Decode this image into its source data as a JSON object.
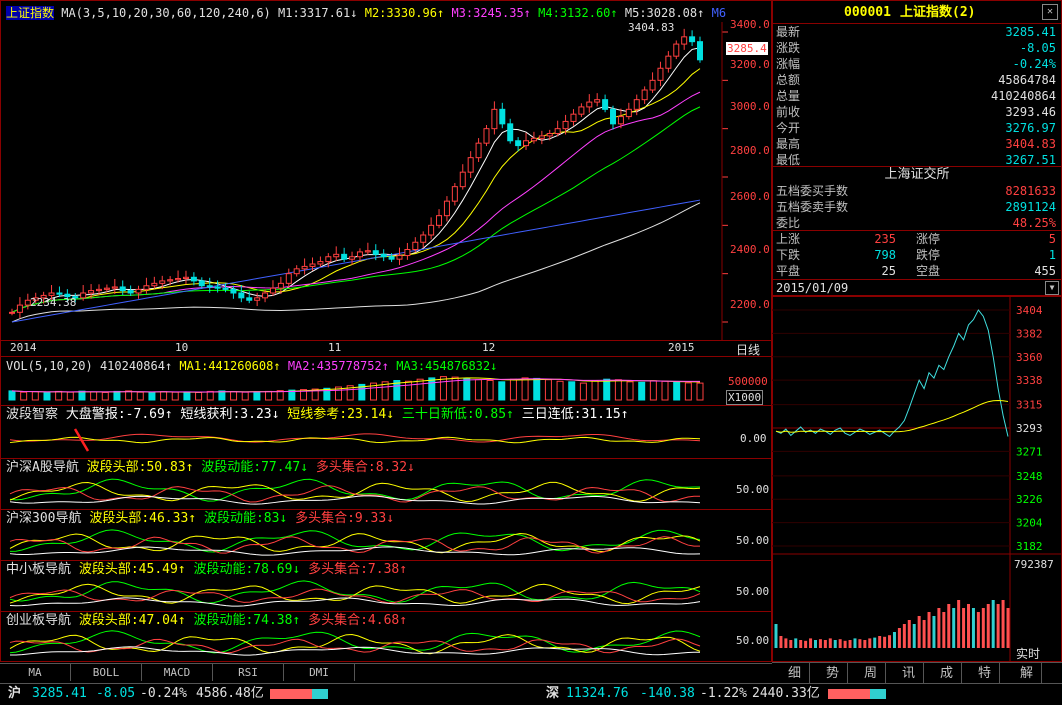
{
  "kline_header": {
    "name": "上证指数",
    "ma_params": "MA(3,5,10,20,30,60,120,240,6)",
    "m1": "M1:3317.61↓",
    "m2": "M2:3330.96↑",
    "m3": "M3:3245.35↑",
    "m4": "M4:3132.60↑",
    "m5": "M5:3028.08↑",
    "m6": "M6"
  },
  "kline": {
    "high_label": "3404.83",
    "low_label": "2234.38",
    "cur_tag": "3285.4",
    "y_axis": [
      "3400.0",
      "3200.0",
      "3000.0",
      "2800.0",
      "2600.0",
      "2400.0",
      "2200.0"
    ],
    "x_axis": [
      "2014",
      "10",
      "11",
      "12",
      "2015"
    ],
    "period": "日线",
    "closes": [
      2240,
      2270,
      2290,
      2300,
      2310,
      2320,
      2315,
      2305,
      2300,
      2320,
      2330,
      2335,
      2340,
      2345,
      2330,
      2320,
      2335,
      2350,
      2360,
      2370,
      2375,
      2380,
      2385,
      2370,
      2350,
      2345,
      2340,
      2335,
      2320,
      2300,
      2290,
      2300,
      2320,
      2340,
      2360,
      2400,
      2420,
      2430,
      2440,
      2450,
      2470,
      2480,
      2460,
      2470,
      2490,
      2495,
      2480,
      2470,
      2460,
      2475,
      2500,
      2530,
      2560,
      2600,
      2640,
      2700,
      2760,
      2820,
      2880,
      2940,
      3000,
      3080,
      3020,
      2950,
      2930,
      2950,
      2960,
      2970,
      2980,
      3000,
      3030,
      3060,
      3090,
      3110,
      3120,
      3080,
      3020,
      3050,
      3080,
      3120,
      3160,
      3200,
      3250,
      3300,
      3350,
      3380,
      3360,
      3285
    ]
  },
  "vol": {
    "header": "VOL(5,10,20)",
    "value": "410240864↑",
    "ma1": "MA1:441260608↑",
    "ma2": "MA2:435778752↑",
    "ma3": "MA3:454876832↓",
    "y_label": "500000",
    "unit": "X1000",
    "bars": [
      0.35,
      0.3,
      0.32,
      0.28,
      0.33,
      0.3,
      0.34,
      0.31,
      0.29,
      0.33,
      0.35,
      0.3,
      0.28,
      0.32,
      0.3,
      0.31,
      0.29,
      0.33,
      0.35,
      0.32,
      0.3,
      0.31,
      0.33,
      0.36,
      0.38,
      0.4,
      0.42,
      0.45,
      0.5,
      0.55,
      0.6,
      0.65,
      0.7,
      0.75,
      0.72,
      0.8,
      0.85,
      0.9,
      0.88,
      0.82,
      0.78,
      0.75,
      0.7,
      0.8,
      0.85,
      0.83,
      0.78,
      0.72,
      0.7,
      0.65,
      0.75,
      0.8,
      0.78,
      0.7,
      0.68,
      0.74,
      0.72,
      0.7,
      0.66,
      0.65
    ]
  },
  "panel1": {
    "title": "波段智察",
    "a": "大盘警报:-7.69↑",
    "b": "短线获利:3.23↓",
    "c": "短线参考:23.14↓",
    "d": "三十日新低:0.85↑",
    "e": "三日连低:31.15↑",
    "y": "0.00"
  },
  "panel2": {
    "title": "沪深A股导航",
    "a": "波段头部:50.83↑",
    "b": "波段动能:77.47↓",
    "c": "多头集合:8.32↓",
    "y": "50.00"
  },
  "panel3": {
    "title": "沪深300导航",
    "a": "波段头部:46.33↑",
    "b": "波段动能:83↓",
    "c": "多头集合:9.33↓",
    "y": "50.00"
  },
  "panel4": {
    "title": "中小板导航",
    "a": "波段头部:45.49↑",
    "b": "波段动能:78.69↓",
    "c": "多头集合:7.38↑",
    "y": "50.00"
  },
  "panel5": {
    "title": "创业板导航",
    "a": "波段头部:47.04↑",
    "b": "波段动能:74.38↑",
    "c": "多头集合:4.68↑",
    "y": "50.00"
  },
  "tabs": [
    "MA",
    "BOLL",
    "MACD",
    "RSI",
    "DMI"
  ],
  "quote": {
    "code": "000001",
    "name": "上证指数(2)",
    "rows": [
      {
        "label": "最新",
        "value": "3285.41",
        "color": "#00e0e0"
      },
      {
        "label": "涨跌",
        "value": "-8.05",
        "color": "#00e0e0"
      },
      {
        "label": "涨幅",
        "value": "-0.24%",
        "color": "#00e0e0"
      },
      {
        "label": "总额",
        "value": "45864784",
        "color": "#e0e0e0"
      },
      {
        "label": "总量",
        "value": "410240864",
        "color": "#e0e0e0"
      },
      {
        "label": "前收",
        "value": "3293.46",
        "color": "#e0e0e0"
      },
      {
        "label": "今开",
        "value": "3276.97",
        "color": "#00e0e0"
      },
      {
        "label": "最高",
        "value": "3404.83",
        "color": "#ff4040"
      },
      {
        "label": "最低",
        "value": "3267.51",
        "color": "#00e0e0"
      }
    ],
    "exchange": "上海证交所",
    "rows2": [
      {
        "label": "五档委买手数",
        "value": "8281633",
        "color": "#ff4040"
      },
      {
        "label": "五档委卖手数",
        "value": "2891124",
        "color": "#00e0e0"
      },
      {
        "label": "委比",
        "value": "48.25%",
        "color": "#ff4040"
      }
    ],
    "ud": [
      {
        "l1": "上涨",
        "v1": "235",
        "c1": "#ff4040",
        "l2": "涨停",
        "v2": "5",
        "c2": "#ff4040"
      },
      {
        "l1": "下跌",
        "v1": "798",
        "c1": "#00e0e0",
        "l2": "跌停",
        "v2": "1",
        "c2": "#00e0e0"
      },
      {
        "l1": "平盘",
        "v1": "25",
        "c1": "#e0e0e0",
        "l2": "空盘",
        "v2": "455",
        "c2": "#e0e0e0"
      }
    ],
    "date": "2015/01/09"
  },
  "intraday": {
    "y_axis": [
      "3404",
      "3382",
      "3360",
      "3338",
      "3315",
      "3293",
      "3271",
      "3248",
      "3226",
      "3204",
      "3182"
    ],
    "vol_top": "792387",
    "realtime": "实时",
    "prices": [
      3290,
      3288,
      3292,
      3286,
      3290,
      3294,
      3289,
      3291,
      3288,
      3292,
      3290,
      3287,
      3291,
      3293,
      3288,
      3286,
      3289,
      3292,
      3290,
      3287,
      3289,
      3291,
      3288,
      3285,
      3290,
      3294,
      3300,
      3312,
      3325,
      3338,
      3330,
      3345,
      3340,
      3352,
      3348,
      3360,
      3370,
      3382,
      3376,
      3390,
      3395,
      3404,
      3398,
      3385,
      3360,
      3330,
      3305,
      3285
    ],
    "vols": [
      0.3,
      0.15,
      0.12,
      0.1,
      0.12,
      0.1,
      0.09,
      0.12,
      0.1,
      0.11,
      0.1,
      0.12,
      0.1,
      0.11,
      0.09,
      0.1,
      0.12,
      0.11,
      0.1,
      0.12,
      0.13,
      0.15,
      0.14,
      0.16,
      0.2,
      0.25,
      0.3,
      0.35,
      0.3,
      0.4,
      0.35,
      0.45,
      0.4,
      0.5,
      0.45,
      0.55,
      0.5,
      0.6,
      0.5,
      0.55,
      0.5,
      0.45,
      0.5,
      0.55,
      0.6,
      0.55,
      0.6,
      0.5
    ]
  },
  "side_tabs": [
    "细",
    "势",
    "周",
    "讯",
    "成",
    "特",
    "解"
  ],
  "status": {
    "sh_label": "沪",
    "sh_price": "3285.41",
    "sh_chg": "-8.05",
    "sh_pct": "-0.24%",
    "sh_amt": "4586.48亿",
    "sz_label": "深",
    "sz_price": "11324.76",
    "sz_chg": "-140.38",
    "sz_pct": "-1.22%",
    "sz_amt": "2440.33亿"
  }
}
